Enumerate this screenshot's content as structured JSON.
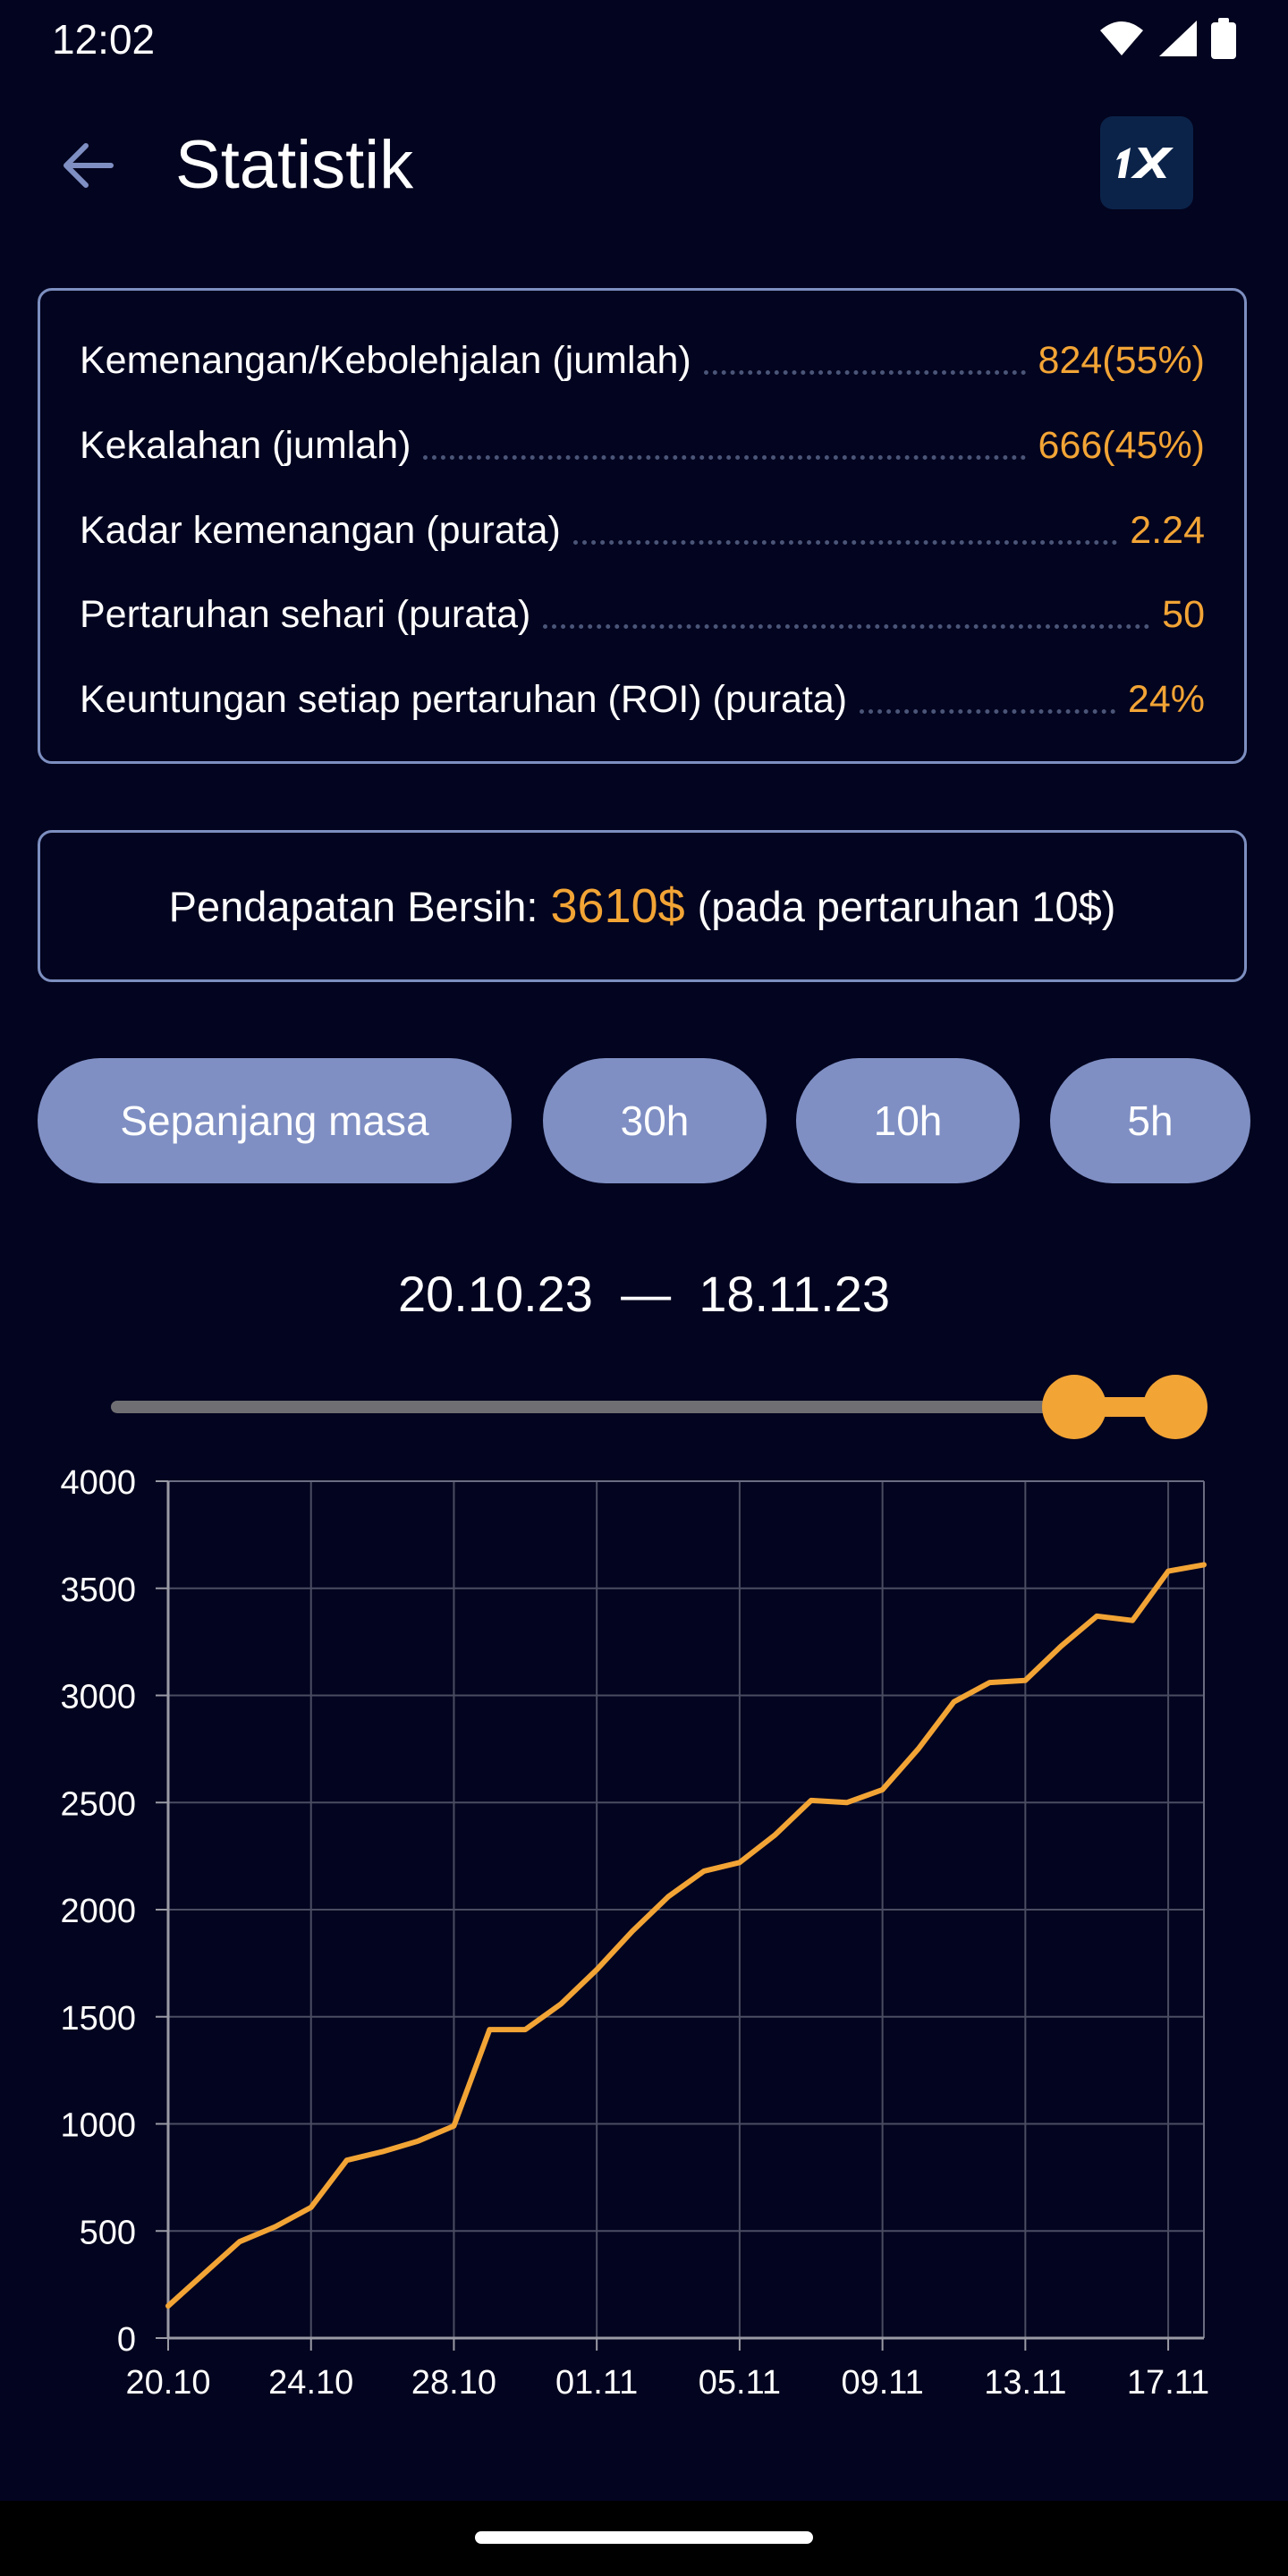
{
  "status_bar": {
    "time": "12:02"
  },
  "header": {
    "title": "Statistik"
  },
  "stats": [
    {
      "label": "Kemenangan/Kebolehjalan (jumlah)",
      "value": "824(55%)"
    },
    {
      "label": "Kekalahan (jumlah)",
      "value": "666(45%)"
    },
    {
      "label": "Kadar kemenangan (purata)",
      "value": "2.24"
    },
    {
      "label": "Pertaruhan sehari (purata)",
      "value": "50"
    },
    {
      "label": "Keuntungan setiap pertaruhan (ROI) (purata)",
      "value": "24%"
    }
  ],
  "income": {
    "label": "Pendapatan Bersih:",
    "value": "3610$",
    "note": "(pada pertaruhan 10$)"
  },
  "filters": [
    {
      "label": "Sepanjang masa"
    },
    {
      "label": "30h"
    },
    {
      "label": "10h"
    },
    {
      "label": "5h"
    }
  ],
  "date_range": {
    "start": "20.10.23",
    "separator": "—",
    "end": "18.11.23"
  },
  "slider": {
    "start_fraction": 0.905,
    "end_fraction": 1.0
  },
  "colors": {
    "accent": "#f2a435",
    "background": "#03041f",
    "button": "#7f8fc3",
    "border": "#7d8fc0"
  },
  "chart_data": {
    "type": "line",
    "x": [
      "20.10",
      "21.10",
      "22.10",
      "23.10",
      "24.10",
      "25.10",
      "26.10",
      "27.10",
      "28.10",
      "29.10",
      "30.10",
      "31.10",
      "01.11",
      "02.11",
      "03.11",
      "04.11",
      "05.11",
      "06.11",
      "07.11",
      "08.11",
      "09.11",
      "10.11",
      "11.11",
      "12.11",
      "13.11",
      "14.11",
      "15.11",
      "16.11",
      "17.11",
      "18.11"
    ],
    "series": [
      {
        "values": [
          150,
          300,
          450,
          520,
          610,
          830,
          870,
          920,
          990,
          1440,
          1440,
          1560,
          1720,
          1900,
          2060,
          2180,
          2220,
          2350,
          2510,
          2500,
          2560,
          2750,
          2970,
          3060,
          3070,
          3230,
          3370,
          3350,
          3580,
          3610
        ]
      }
    ],
    "x_tick_labels": [
      "20.10",
      "24.10",
      "28.10",
      "01.11",
      "05.11",
      "09.11",
      "13.11",
      "17.11"
    ],
    "x_tick_indices": [
      0,
      4,
      8,
      12,
      16,
      20,
      24,
      28
    ],
    "y_ticks": [
      0,
      500,
      1000,
      1500,
      2000,
      2500,
      3000,
      3500,
      4000
    ],
    "ylim": [
      0,
      4000
    ],
    "grid": true,
    "line_color": "#f2a435"
  }
}
